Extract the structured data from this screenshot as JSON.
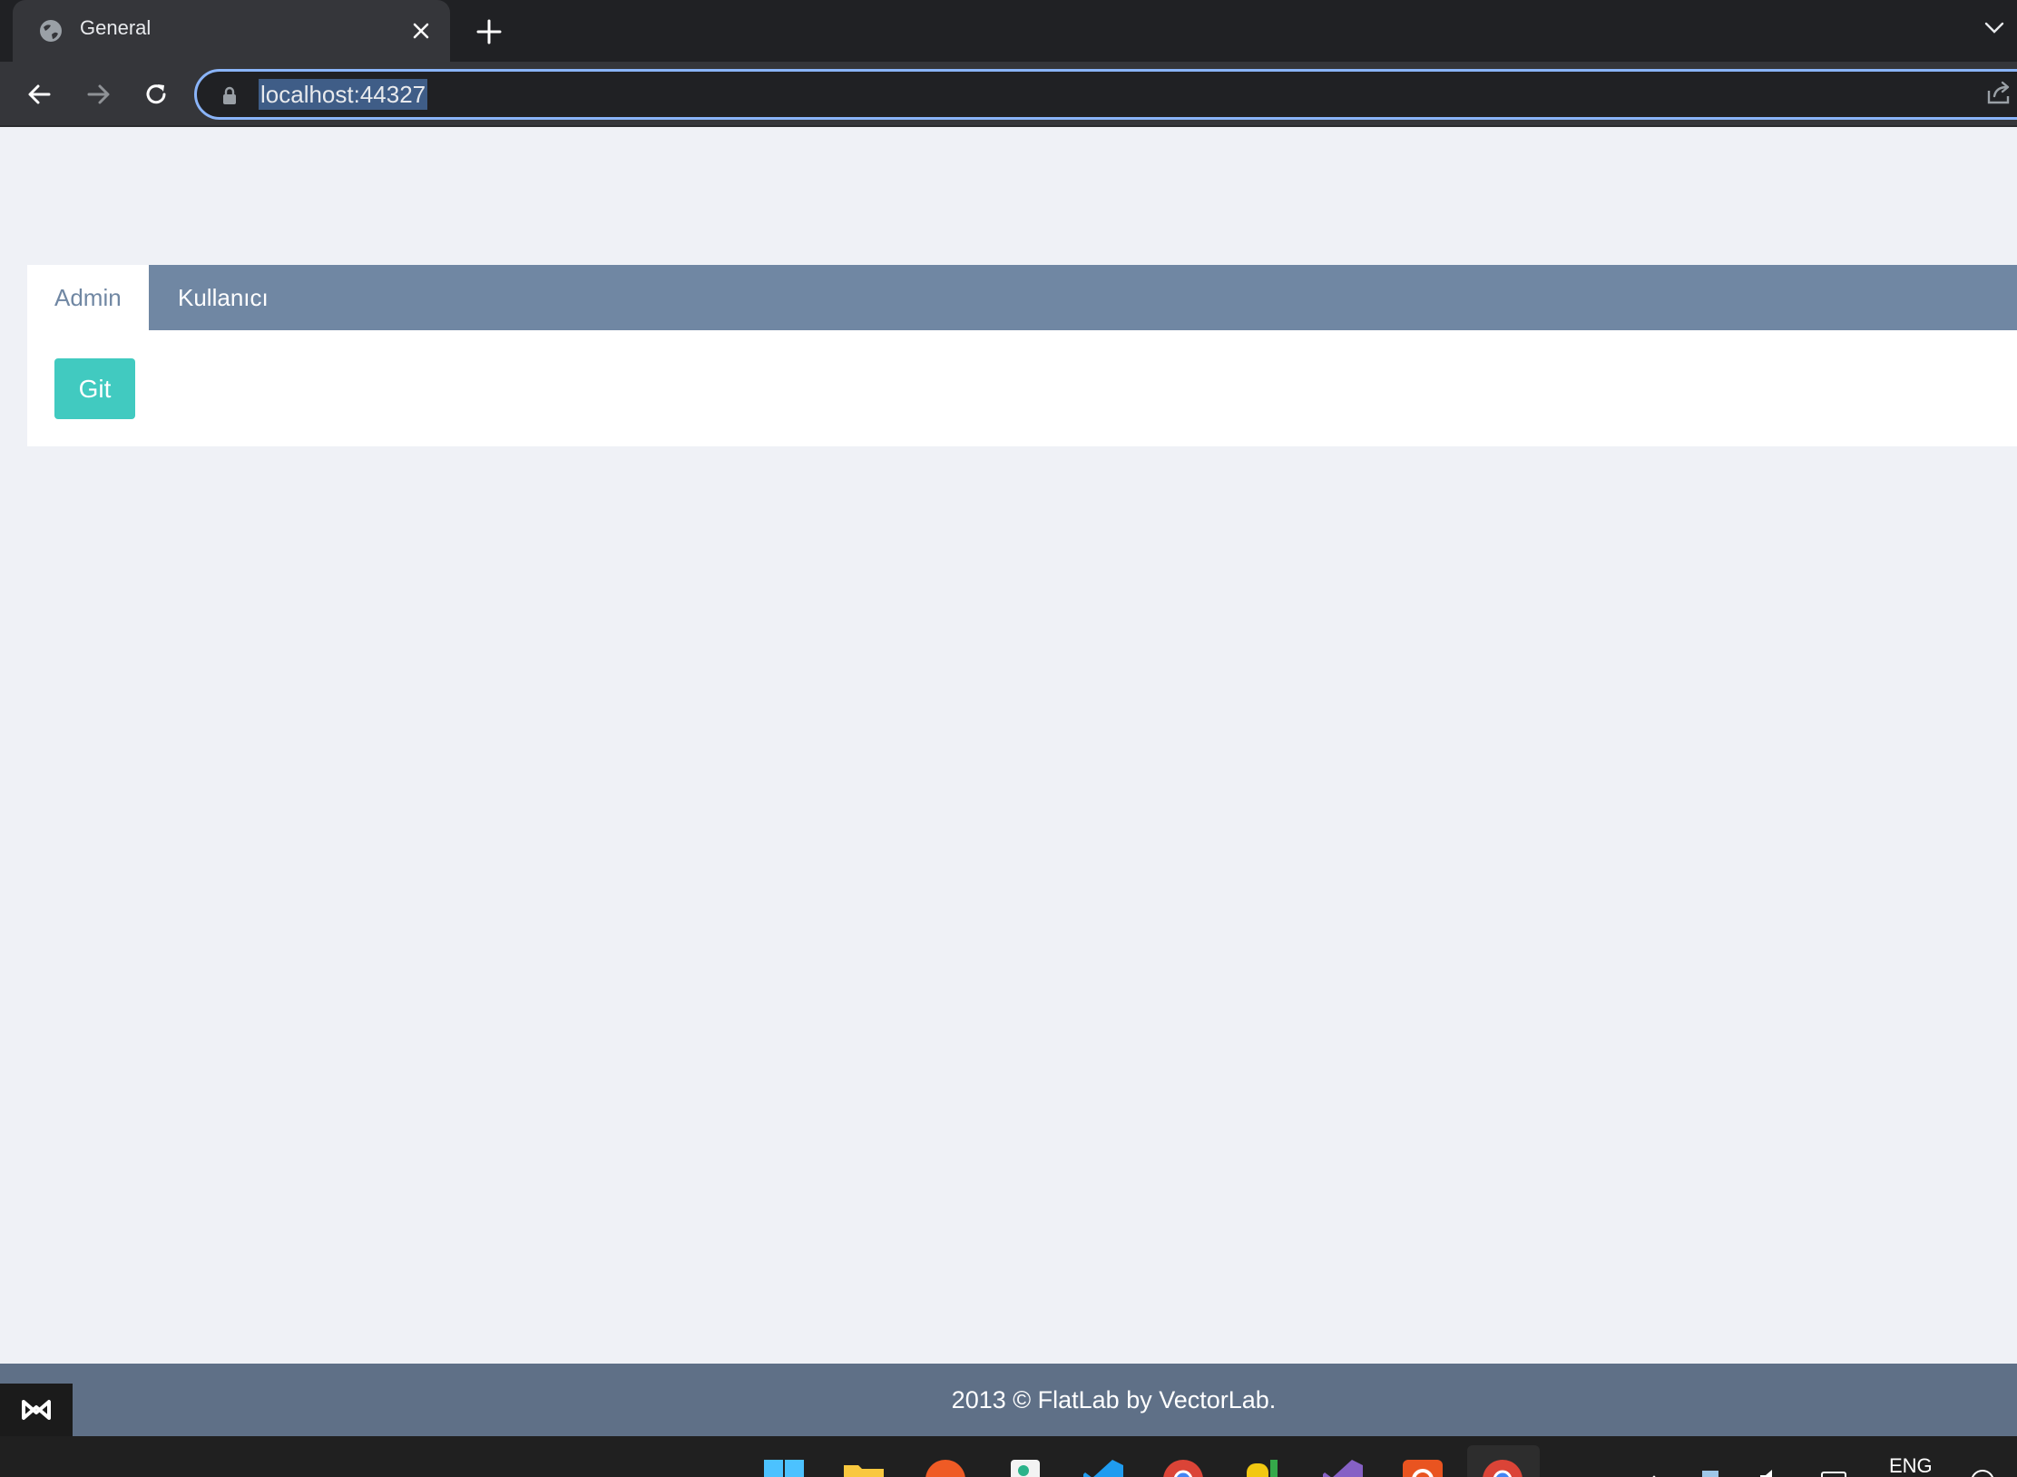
{
  "browser": {
    "tab_title": "General",
    "url": "localhost:44327"
  },
  "page": {
    "tabs": [
      {
        "label": "Admin",
        "active": true
      },
      {
        "label": "Kullanıcı",
        "active": false
      }
    ],
    "git_button_label": "Git",
    "footer_text": "2013 © FlatLab by VectorLab."
  },
  "taskbar": {
    "language": "ENG",
    "apps": [
      "windows-start",
      "file-explorer",
      "postman",
      "notepad",
      "vscode",
      "chrome",
      "sql-server",
      "visual-studio",
      "ubuntu",
      "chrome-active"
    ]
  },
  "colors": {
    "tab_bar": "#7087a3",
    "button": "#41cac0",
    "footer": "#5f7087",
    "page_bg": "#eff1f6"
  }
}
